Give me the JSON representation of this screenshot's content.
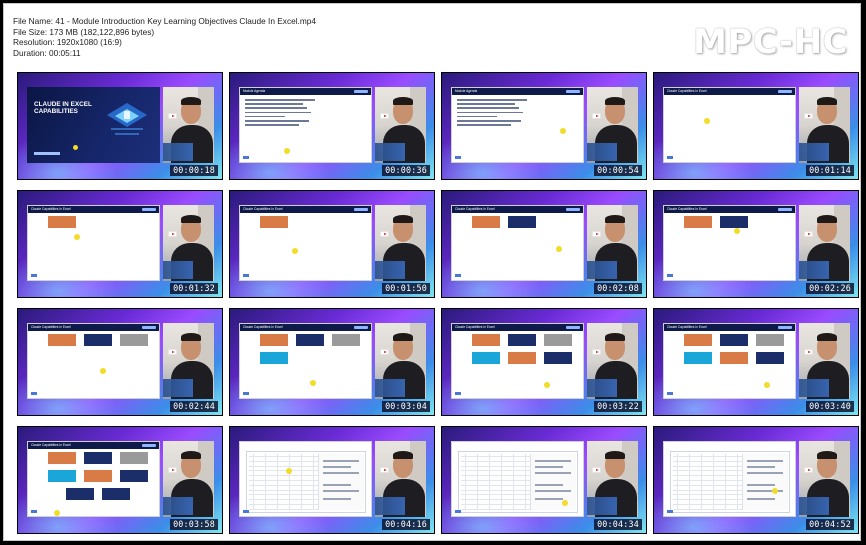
{
  "info": {
    "file_name": "File Name: 41 - Module Introduction Key Learning Objectives Claude In Excel.mp4",
    "file_size": "File Size: 173 MB (182,122,896 bytes)",
    "resolution": "Resolution: 1920x1080 (16:9)",
    "duration": "Duration: 00:05:11"
  },
  "brand": "MPC-HC",
  "title_slide": {
    "title": "CLAUDE IN EXCEL CAPABILITIES"
  },
  "slide_headers": {
    "agenda": "Module Agenda",
    "capabilities": "Claude Capabilities In Excel"
  },
  "colors": {
    "orange": "#d97b46",
    "navy": "#1b2e6a",
    "gray": "#9a9a9a",
    "cyan": "#1aa6d8",
    "yellow": "#f2dc2a"
  },
  "thumbnails": [
    {
      "time": "00:00:18",
      "kind": "title",
      "boxes": []
    },
    {
      "time": "00:00:36",
      "kind": "agenda",
      "boxes": []
    },
    {
      "time": "00:00:54",
      "kind": "agenda",
      "boxes": []
    },
    {
      "time": "00:01:14",
      "kind": "blank",
      "boxes": []
    },
    {
      "time": "00:01:32",
      "kind": "boxes",
      "boxes": [
        "orange"
      ]
    },
    {
      "time": "00:01:50",
      "kind": "boxes",
      "boxes": [
        "orange"
      ]
    },
    {
      "time": "00:02:08",
      "kind": "boxes",
      "boxes": [
        "orange",
        "navy"
      ]
    },
    {
      "time": "00:02:26",
      "kind": "boxes",
      "boxes": [
        "orange",
        "navy"
      ]
    },
    {
      "time": "00:02:44",
      "kind": "boxes",
      "boxes": [
        "orange",
        "navy",
        "gray"
      ]
    },
    {
      "time": "00:03:04",
      "kind": "boxes",
      "boxes": [
        "orange",
        "navy",
        "gray",
        "cyan"
      ]
    },
    {
      "time": "00:03:22",
      "kind": "boxes",
      "boxes": [
        "orange",
        "navy",
        "gray",
        "cyan",
        "orange",
        "navy"
      ]
    },
    {
      "time": "00:03:40",
      "kind": "boxes",
      "boxes": [
        "orange",
        "navy",
        "gray",
        "cyan",
        "orange",
        "navy"
      ]
    },
    {
      "time": "00:03:58",
      "kind": "boxes",
      "boxes": [
        "orange",
        "navy",
        "gray",
        "cyan",
        "orange",
        "navy",
        "navy",
        "navy"
      ]
    },
    {
      "time": "00:04:16",
      "kind": "excel",
      "boxes": []
    },
    {
      "time": "00:04:34",
      "kind": "excel",
      "boxes": []
    },
    {
      "time": "00:04:52",
      "kind": "excel",
      "boxes": []
    }
  ]
}
